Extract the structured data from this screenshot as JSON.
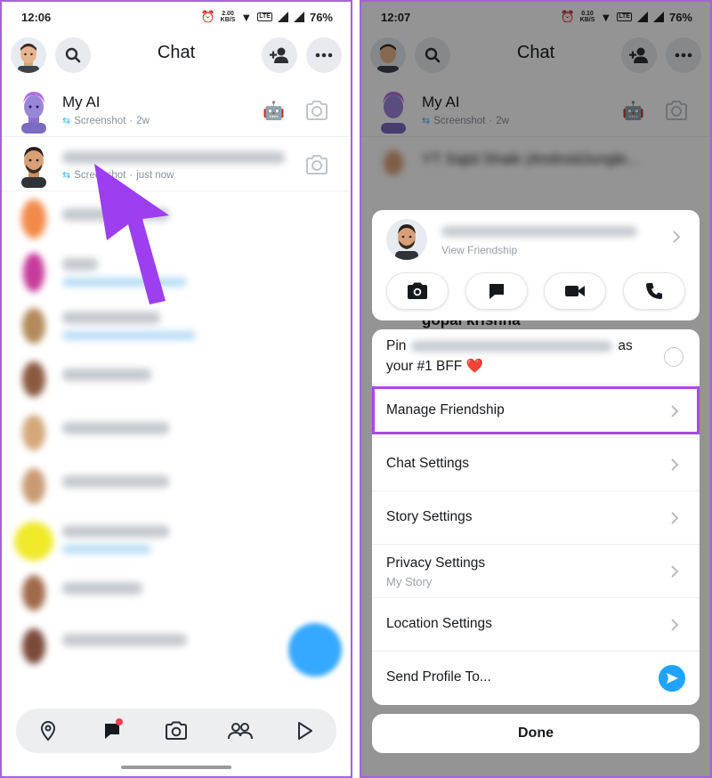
{
  "left": {
    "status_time": "12:06",
    "net_speed": "2.00",
    "net_unit": "KB/S",
    "battery": "76%",
    "header_title": "Chat",
    "rows": [
      {
        "name": "My AI",
        "sub_label": "Screenshot",
        "sub_time": "2w",
        "badge": "🤖"
      },
      {
        "name": "",
        "sub_label": "Screenshot",
        "sub_time": "just now"
      }
    ]
  },
  "right": {
    "status_time": "12:07",
    "net_speed": "0.10",
    "net_unit": "KB/S",
    "battery": "76%",
    "header_title": "Chat",
    "under_rows": [
      {
        "name": "My AI",
        "sub_label": "Screenshot",
        "sub_time": "2w"
      },
      {
        "name": "YT Sajid Shaik (AndroidJungle..."
      },
      {
        "name": "gopal krishna"
      }
    ],
    "profile_card": {
      "sub": "View Friendship"
    },
    "pin": {
      "prefix": "Pin",
      "suffix": "as",
      "line2": "your #1 BFF ❤️"
    },
    "menu": [
      {
        "label": "Manage Friendship"
      },
      {
        "label": "Chat Settings"
      },
      {
        "label": "Story Settings"
      },
      {
        "label": "Privacy Settings",
        "sub": "My Story"
      },
      {
        "label": "Location Settings"
      },
      {
        "label": "Send Profile To..."
      }
    ],
    "done_label": "Done"
  },
  "colors": {
    "accent_purple": "#a64ae8",
    "snap_blue": "#1fa3ff",
    "notify_red": "#f23c57"
  }
}
